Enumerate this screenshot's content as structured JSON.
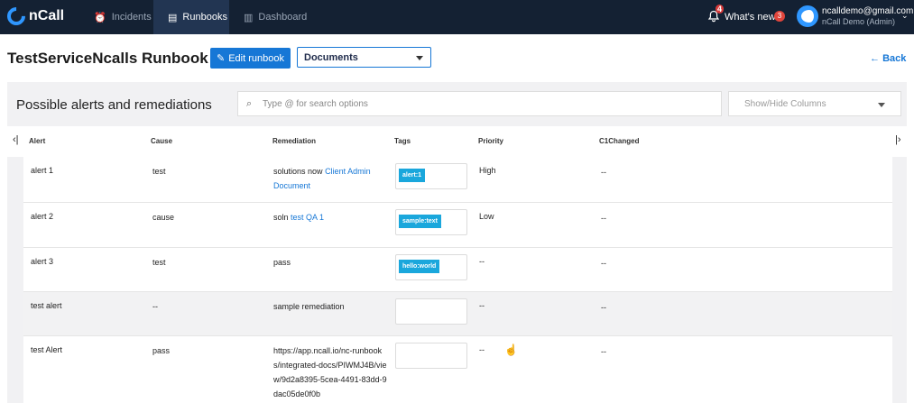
{
  "nav": {
    "logo_text": "nCall",
    "items": [
      {
        "label": "Incidents",
        "icon": "alarm-icon"
      },
      {
        "label": "Runbooks",
        "icon": "book-icon"
      },
      {
        "label": "Dashboard",
        "icon": "bar-chart-icon"
      }
    ],
    "notification_count": "4",
    "whats_new_label": "What's new?",
    "whats_new_count": "3",
    "user_email": "ncalldemo@gmail.com",
    "user_role": "nCall Demo (Admin)"
  },
  "header": {
    "title": "TestServiceNcalls Runbook",
    "edit_label": "Edit runbook",
    "select_value": "Documents",
    "back_label": "Back"
  },
  "panel": {
    "title": "Possible alerts and remediations",
    "search_placeholder": "Type @ for search options",
    "columns_label": "Show/Hide Columns"
  },
  "table": {
    "headers": [
      "Alert",
      "Cause",
      "Remediation",
      "Tags",
      "Priority",
      "C1Changed"
    ],
    "rows": [
      {
        "alert": "alert 1",
        "cause": "test",
        "rem_text": "solutions now",
        "rem_link": "Client Admin Document",
        "tag": "alert:1",
        "priority": "High",
        "c1": "--"
      },
      {
        "alert": "alert 2",
        "cause": "cause",
        "rem_text": "soln",
        "rem_link": "test QA 1",
        "tag": "sample:text",
        "priority": "Low",
        "c1": "--"
      },
      {
        "alert": "alert 3",
        "cause": "test",
        "rem_text": "pass",
        "rem_link": "",
        "tag": "hello:world",
        "priority": "--",
        "c1": "--"
      },
      {
        "alert": "test alert",
        "cause": "--",
        "rem_text": "sample remediation",
        "rem_link": "",
        "tag": "",
        "priority": "--",
        "c1": "--"
      },
      {
        "alert": "test Alert",
        "cause": "pass",
        "rem_text": "https://app.ncall.io/nc-runbooks/integrated-docs/PIWMJ4B/view/9d2a8395-5cea-4491-83dd-9dac05de0f0b",
        "rem_link": "",
        "tag": "",
        "priority": "--",
        "c1": "--"
      }
    ]
  }
}
